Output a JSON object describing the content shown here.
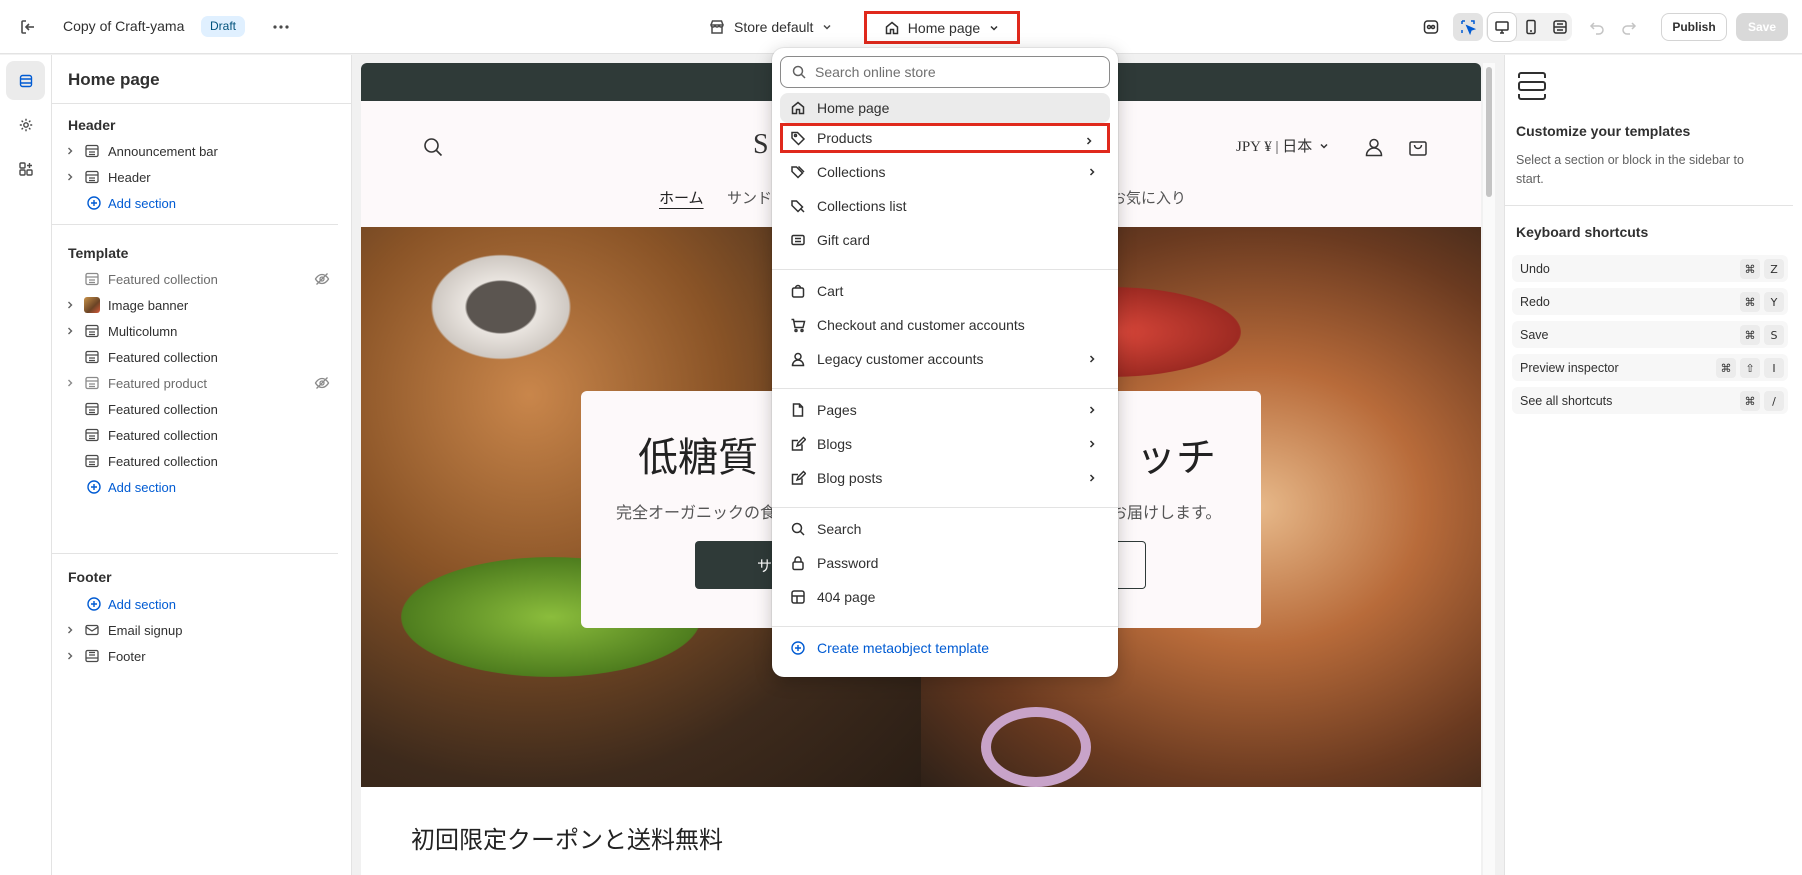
{
  "topbar": {
    "theme_title": "Copy of Craft-yama",
    "badge": "Draft",
    "store_selector": "Store default",
    "page_selector": "Home page",
    "publish": "Publish",
    "save": "Save"
  },
  "sidebar": {
    "title": "Home page",
    "header_group": "Header",
    "header_items": [
      "Announcement bar",
      "Header"
    ],
    "add_section": "Add section",
    "template_group": "Template",
    "template_items": [
      "Featured collection",
      "Image banner",
      "Multicolumn",
      "Featured collection",
      "Featured product",
      "Featured collection",
      "Featured collection",
      "Featured collection"
    ],
    "footer_group": "Footer",
    "footer_items": [
      "Email signup",
      "Footer"
    ]
  },
  "preview": {
    "logo": "S",
    "currency": "JPY ¥ | 日本",
    "nav": [
      "ホーム",
      "サンド",
      "お気に入り"
    ],
    "hero_title_left": "低糖質",
    "hero_title_right": "ッチ",
    "hero_sub_left": "完全オーガニックの食",
    "hero_sub_right": "お届けします。",
    "hero_button": "サ",
    "coupon_heading": "初回限定クーポンと送料無料"
  },
  "dropdown": {
    "search_placeholder": "Search online store",
    "items": [
      "Home page",
      "Products",
      "Collections",
      "Collections list",
      "Gift card",
      "Cart",
      "Checkout and customer accounts",
      "Legacy customer accounts",
      "Pages",
      "Blogs",
      "Blog posts",
      "Search",
      "Password",
      "404 page",
      "Create metaobject template"
    ]
  },
  "right_panel": {
    "heading": "Customize your templates",
    "description": "Select a section or block in the sidebar to start.",
    "shortcuts_heading": "Keyboard shortcuts",
    "shortcuts": [
      {
        "label": "Undo",
        "keys": [
          "⌘",
          "Z"
        ]
      },
      {
        "label": "Redo",
        "keys": [
          "⌘",
          "Y"
        ]
      },
      {
        "label": "Save",
        "keys": [
          "⌘",
          "S"
        ]
      },
      {
        "label": "Preview inspector",
        "keys": [
          "⌘",
          "⇧",
          "I"
        ]
      },
      {
        "label": "See all shortcuts",
        "keys": [
          "⌘",
          "/"
        ]
      }
    ]
  },
  "colors": {
    "accent_highlight": "#e0291c",
    "link": "#005bd3",
    "announcement_bar": "#2f3a38"
  }
}
